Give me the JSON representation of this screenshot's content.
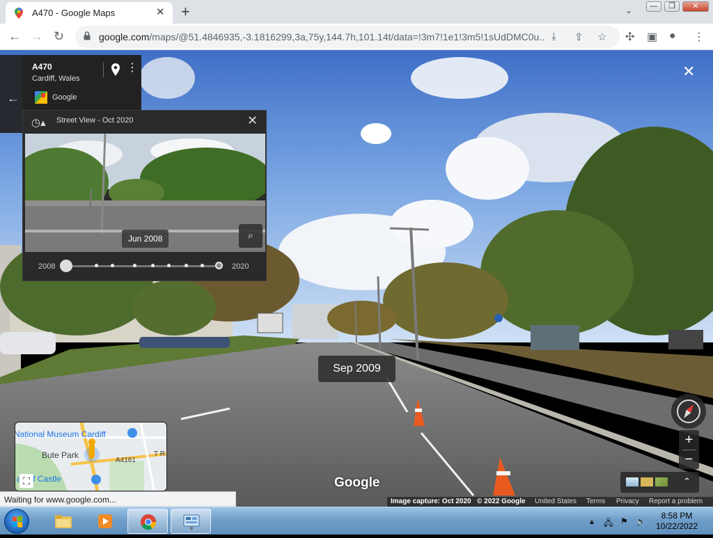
{
  "browser": {
    "tab_title": "A470 - Google Maps",
    "new_tab": "+",
    "tab_close": "✕",
    "url_host": "google.com",
    "url_path": "/maps/@51.4846935,-3.1816299,3a,75y,144.7h,101.14t/data=!3m7!1e1!3m5!1sUdDMC0u...",
    "window_controls": [
      "—",
      "❐",
      "✕"
    ]
  },
  "place": {
    "name": "A470",
    "address": "Cardiff, Wales",
    "provider": "Google"
  },
  "time_travel": {
    "header": "Street View - Oct 2020",
    "thumb_date": "Jun 2008",
    "year_start": "2008",
    "year_end": "2020",
    "selected_fraction": 0.0
  },
  "view": {
    "date_badge": "Sep 2009",
    "wordmark": "Google",
    "exit": "✕"
  },
  "controls": {
    "zoom_in": "+",
    "zoom_out": "−",
    "expand": "⌃"
  },
  "minimap": {
    "labels": [
      "National Museum Cardiff",
      "Bute Park",
      "A4161",
      "T R",
      "ardiff Castle"
    ]
  },
  "footer": {
    "capture": "Image capture: Oct 2020",
    "copyright": "© 2022 Google",
    "country": "United States",
    "terms": "Terms",
    "privacy": "Privacy",
    "report": "Report a problem"
  },
  "status_text": "Waiting for www.google.com...",
  "taskbar": {
    "time": "8:58 PM",
    "date": "10/22/2022"
  },
  "colors": {
    "maps_blue": "#1a73e8",
    "panel_bg": "#2a2a2a",
    "taskbar": "#6f9ec9"
  }
}
